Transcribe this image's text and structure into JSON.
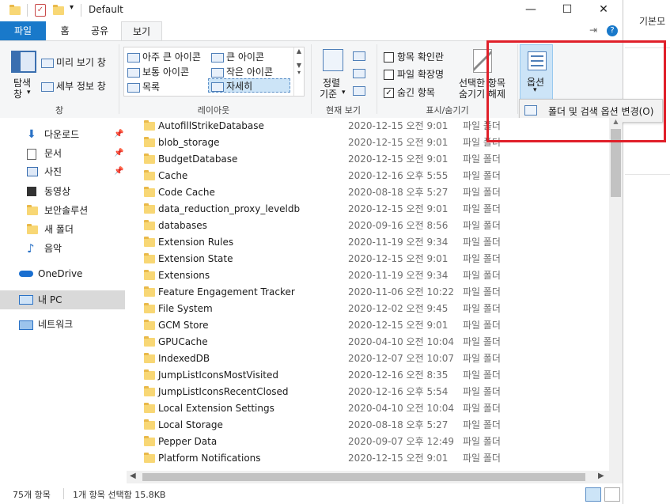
{
  "window": {
    "title": "Default",
    "controls": {
      "minimize": "—",
      "maximize": "☐",
      "close": "✕"
    }
  },
  "tabs": {
    "file": "파일",
    "home": "홈",
    "share": "공유",
    "view": "보기"
  },
  "ribbon": {
    "pane_group": {
      "nav_pane": "탐색\n창",
      "nav_pane_l1": "탐색",
      "nav_pane_l2": "창",
      "preview": "미리 보기 창",
      "details": "세부 정보 창",
      "label": "창"
    },
    "layout_group": {
      "items": [
        "아주 큰 아이콘",
        "큰 아이콘",
        "보통 아이콘",
        "작은 아이콘",
        "목록",
        "자세히"
      ],
      "label": "레이아웃"
    },
    "current_view": {
      "sort_l1": "정렬",
      "sort_l2": "기준",
      "label": "현재 보기"
    },
    "show_hide": {
      "item_checkboxes": "항목 확인란",
      "file_ext": "파일 확장명",
      "hidden_items": "숨긴 항목",
      "hide_selected_l1": "선택한 항목",
      "hide_selected_l2": "숨기기 해제",
      "label": "표시/숨기기"
    },
    "options": {
      "label": "옵션"
    },
    "options_menu": {
      "change_folder_options": "폴더 및 검색 옵션 변경(O)"
    }
  },
  "behind_window": {
    "text": "기본모"
  },
  "nav": {
    "items": [
      {
        "label": "다운로드",
        "icon": "download-icon"
      },
      {
        "label": "문서",
        "icon": "document-icon"
      },
      {
        "label": "사진",
        "icon": "pictures-icon"
      },
      {
        "label": "동영상",
        "icon": "video-icon"
      },
      {
        "label": "보안솔루션",
        "icon": "folder-icon"
      },
      {
        "label": "새 폴더",
        "icon": "folder-icon"
      },
      {
        "label": "음악",
        "icon": "music-icon"
      },
      {
        "label": "OneDrive",
        "icon": "onedrive-icon"
      },
      {
        "label": "내 PC",
        "icon": "this-pc-icon"
      },
      {
        "label": "네트워크",
        "icon": "network-icon"
      }
    ]
  },
  "files": [
    {
      "name": "AutofillStrikeDatabase",
      "date": "2020-12-15 오전 9:01",
      "type": "파일 폴더"
    },
    {
      "name": "blob_storage",
      "date": "2020-12-15 오전 9:01",
      "type": "파일 폴더"
    },
    {
      "name": "BudgetDatabase",
      "date": "2020-12-15 오전 9:01",
      "type": "파일 폴더"
    },
    {
      "name": "Cache",
      "date": "2020-12-16 오후 5:55",
      "type": "파일 폴더"
    },
    {
      "name": "Code Cache",
      "date": "2020-08-18 오후 5:27",
      "type": "파일 폴더"
    },
    {
      "name": "data_reduction_proxy_leveldb",
      "date": "2020-12-15 오전 9:01",
      "type": "파일 폴더"
    },
    {
      "name": "databases",
      "date": "2020-09-16 오전 8:56",
      "type": "파일 폴더"
    },
    {
      "name": "Extension Rules",
      "date": "2020-11-19 오전 9:34",
      "type": "파일 폴더"
    },
    {
      "name": "Extension State",
      "date": "2020-12-15 오전 9:01",
      "type": "파일 폴더"
    },
    {
      "name": "Extensions",
      "date": "2020-11-19 오전 9:34",
      "type": "파일 폴더"
    },
    {
      "name": "Feature Engagement Tracker",
      "date": "2020-11-06 오전 10:22",
      "type": "파일 폴더"
    },
    {
      "name": "File System",
      "date": "2020-12-02 오전 9:45",
      "type": "파일 폴더"
    },
    {
      "name": "GCM Store",
      "date": "2020-12-15 오전 9:01",
      "type": "파일 폴더"
    },
    {
      "name": "GPUCache",
      "date": "2020-04-10 오전 10:04",
      "type": "파일 폴더"
    },
    {
      "name": "IndexedDB",
      "date": "2020-12-07 오전 10:07",
      "type": "파일 폴더"
    },
    {
      "name": "JumpListIconsMostVisited",
      "date": "2020-12-16 오전 8:35",
      "type": "파일 폴더"
    },
    {
      "name": "JumpListIconsRecentClosed",
      "date": "2020-12-16 오후 5:54",
      "type": "파일 폴더"
    },
    {
      "name": "Local Extension Settings",
      "date": "2020-04-10 오전 10:04",
      "type": "파일 폴더"
    },
    {
      "name": "Local Storage",
      "date": "2020-08-18 오후 5:27",
      "type": "파일 폴더"
    },
    {
      "name": "Pepper Data",
      "date": "2020-09-07 오후 12:49",
      "type": "파일 폴더"
    },
    {
      "name": "Platform Notifications",
      "date": "2020-12-15 오전 9:01",
      "type": "파일 폴더"
    }
  ],
  "status": {
    "count": "75개 항목",
    "selected": "1개 항목 선택함 15.8KB"
  },
  "colors": {
    "accent": "#1979ca",
    "highlight": "#e0202a",
    "folder": "#f8d775"
  }
}
